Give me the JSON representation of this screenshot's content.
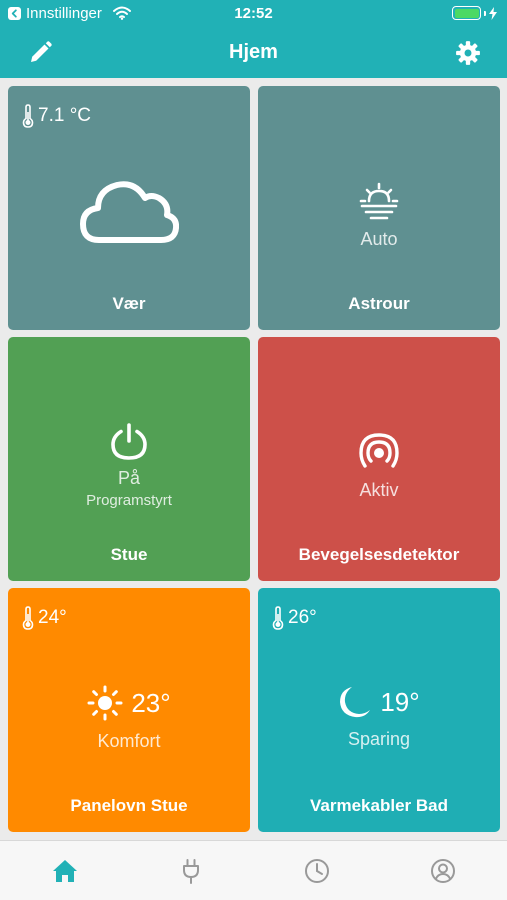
{
  "status_bar": {
    "back_app": "Innstillinger",
    "time": "12:52"
  },
  "header": {
    "title": "Hjem",
    "edit_icon": "pencil-icon",
    "settings_icon": "gear-icon"
  },
  "colors": {
    "accent": "#21b1b6",
    "tile_neutral": "#5f9091",
    "tile_on": "#52a054",
    "tile_alert": "#cd5049",
    "tile_heat": "#ff8a00",
    "tile_cool": "#1faeb4",
    "tab_active": "#21b1b6",
    "tab_inactive": "#999999"
  },
  "tiles": [
    {
      "name": "Vær",
      "temperature": "7.1 °C",
      "icon": "cloud-icon"
    },
    {
      "name": "Astrour",
      "state": "Auto",
      "icon": "sunrise-icon"
    },
    {
      "name": "Stue",
      "state": "På",
      "mode": "Programstyrt",
      "icon": "power-icon"
    },
    {
      "name": "Bevegelsesdetektor",
      "state": "Aktiv",
      "icon": "motion-sensor-icon"
    },
    {
      "name": "Panelovn Stue",
      "temperature": "24°",
      "setpoint": "23°",
      "mode": "Komfort",
      "icon": "sun-icon"
    },
    {
      "name": "Varmekabler Bad",
      "temperature": "26°",
      "setpoint": "19°",
      "mode": "Sparing",
      "icon": "moon-icon"
    }
  ],
  "tabs": [
    {
      "name": "home",
      "icon": "home-icon",
      "active": true
    },
    {
      "name": "devices",
      "icon": "plug-icon",
      "active": false
    },
    {
      "name": "schedule",
      "icon": "clock-icon",
      "active": false
    },
    {
      "name": "profile",
      "icon": "user-icon",
      "active": false
    }
  ]
}
